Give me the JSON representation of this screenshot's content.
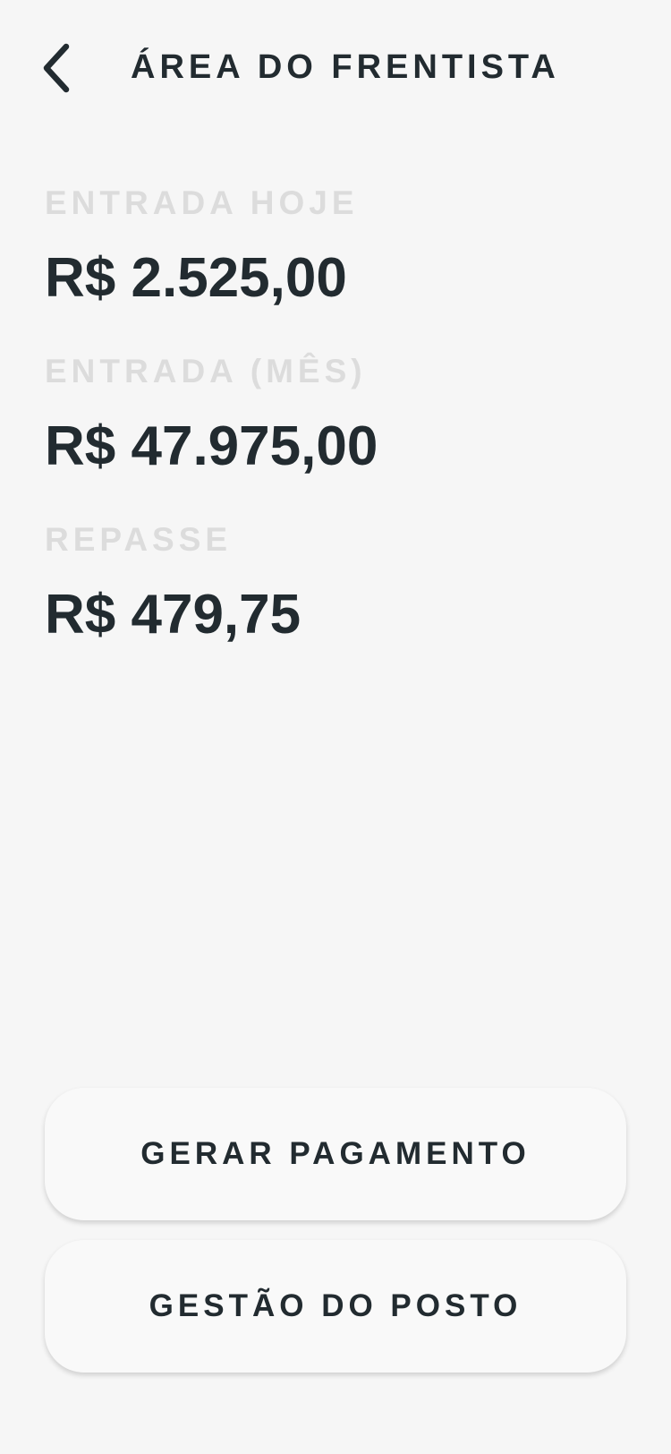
{
  "header": {
    "title": "ÁREA DO FRENTISTA",
    "back_icon": "chevron-left-icon"
  },
  "stats": [
    {
      "label": "ENTRADA HOJE",
      "value": "R$ 2.525,00"
    },
    {
      "label": "ENTRADA (MÊS)",
      "value": "R$ 47.975,00"
    },
    {
      "label": "REPASSE",
      "value": "R$ 479,75"
    }
  ],
  "actions": {
    "generate_payment": "GERAR PAGAMENTO",
    "station_management": "GESTÃO DO POSTO"
  },
  "colors": {
    "background": "#f6f6f6",
    "text": "#222b30",
    "label": "#dcdcdc",
    "button_bg": "#f9f9f9"
  }
}
